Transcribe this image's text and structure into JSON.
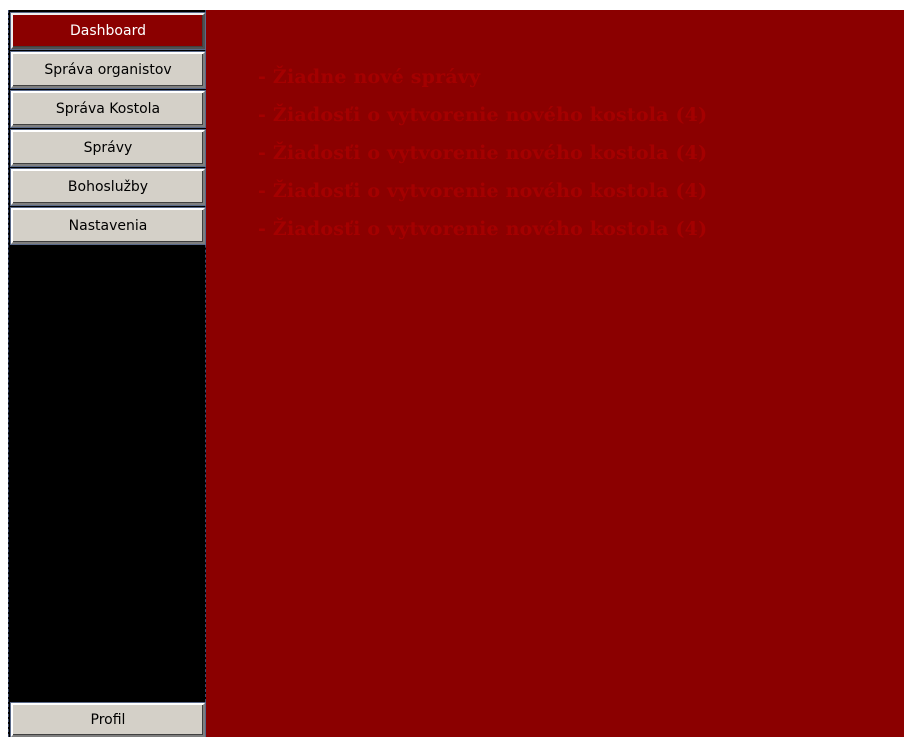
{
  "colors": {
    "main_background": "#8b0000",
    "sidebar_background": "#000000",
    "button_face": "#d4d0c8",
    "active_button": "#8b0000",
    "message_text": "#a40000"
  },
  "sidebar": {
    "items": [
      {
        "label": "Dashboard",
        "active": true
      },
      {
        "label": "Správa organistov",
        "active": false
      },
      {
        "label": "Správa Kostola",
        "active": false
      },
      {
        "label": "Správy",
        "active": false
      },
      {
        "label": "Bohoslužby",
        "active": false
      },
      {
        "label": "Nastavenia",
        "active": false
      }
    ],
    "profile_label": "Profil"
  },
  "main": {
    "messages": [
      "- Žiadne nové správy",
      "- Žiadosťi o vytvorenie nového kostola (4)",
      "- Žiadosťi o vytvorenie nového kostola (4)",
      "- Žiadosťi o vytvorenie nového kostola (4)",
      "- Žiadosťi o vytvorenie nového kostola (4)"
    ]
  }
}
